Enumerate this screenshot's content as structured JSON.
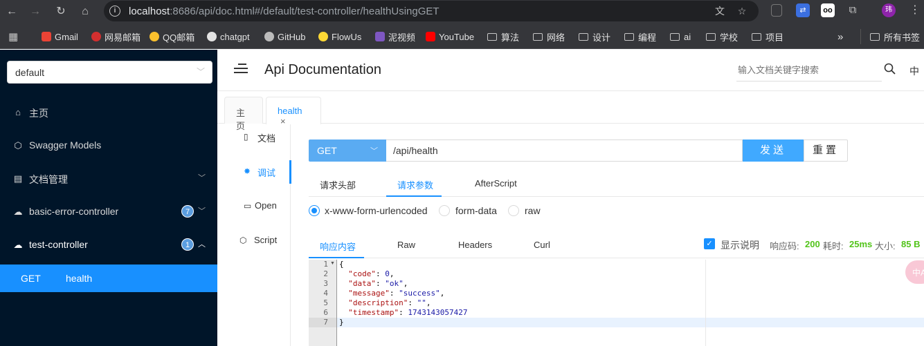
{
  "browser": {
    "url_host": "localhost",
    "url_rest": ":8686/api/doc.html#/default/test-controller/healthUsingGET",
    "avatar_initial": "玮",
    "bookmarks": [
      "Gmail",
      "网易邮箱",
      "QQ邮箱",
      "chatgpt",
      "GitHub",
      "FlowUs",
      "泥视频",
      "YouTube",
      "算法",
      "网络",
      "设计",
      "编程",
      "ai",
      "学校",
      "项目"
    ],
    "more_bookmarks": "»",
    "all_bookmarks": "所有书签"
  },
  "sidebar": {
    "group_select": "default",
    "items": [
      {
        "label": "主页",
        "icon": "home-icon"
      },
      {
        "label": "Swagger Models",
        "icon": "models-icon"
      },
      {
        "label": "文档管理",
        "icon": "document-icon"
      },
      {
        "label": "basic-error-controller",
        "icon": "cloud-icon",
        "badge": "7"
      },
      {
        "label": "test-controller",
        "icon": "cloud-icon",
        "badge": "1"
      }
    ],
    "subitem": {
      "method": "GET",
      "label": "health"
    }
  },
  "header": {
    "title": "Api Documentation",
    "search_placeholder": "输入文档关键字搜索",
    "lang": "中"
  },
  "tabs": [
    {
      "label": "主页"
    },
    {
      "label": "health",
      "close": "×"
    }
  ],
  "docnav": [
    {
      "label": "文档",
      "icon": "doc-icon"
    },
    {
      "label": "调试",
      "icon": "bug-icon"
    },
    {
      "label": "Open",
      "icon": "file-icon"
    },
    {
      "label": "Script",
      "icon": "script-icon"
    }
  ],
  "request": {
    "method": "GET",
    "url": "/api/health",
    "send": "发送",
    "reset": "重置",
    "tabs": [
      "请求头部",
      "请求参数",
      "AfterScript"
    ],
    "content_types": [
      "x-www-form-urlencoded",
      "form-data",
      "raw"
    ]
  },
  "response": {
    "tabs": [
      "响应内容",
      "Raw",
      "Headers",
      "Curl"
    ],
    "show_desc": "显示说明",
    "status_label": "响应码:",
    "status": "200",
    "time_label": "耗时:",
    "time": "25ms",
    "size_label": "大小:",
    "size": "85 B",
    "line_numbers": [
      "1",
      "2",
      "3",
      "4",
      "5",
      "6",
      "7"
    ],
    "body": {
      "l1": "{",
      "code_key": "\"code\"",
      "code_val": "0",
      "data_key": "\"data\"",
      "data_val": "\"ok\"",
      "message_key": "\"message\"",
      "message_val": "\"success\"",
      "description_key": "\"description\"",
      "description_val": "\"\"",
      "timestamp_key": "\"timestamp\"",
      "timestamp_val": "1743143057427",
      "l7": "}"
    }
  },
  "floating": {
    "label": "中A"
  },
  "colors": {
    "accent": "#1890ff",
    "sidebar_bg": "#001529",
    "success": "#52c41a",
    "method_bg": "#5aabf2"
  }
}
